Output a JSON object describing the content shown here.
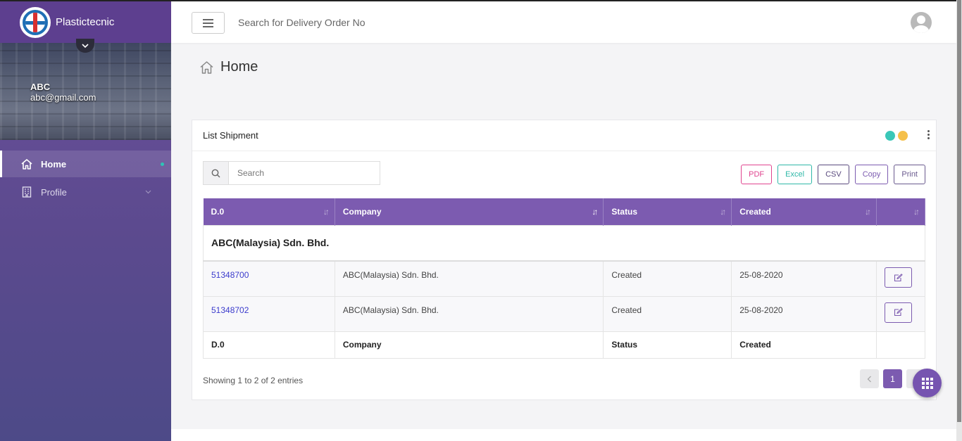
{
  "app": {
    "brand": "Plastictecnic"
  },
  "user": {
    "name": "ABC",
    "email": "abc@gmail.com"
  },
  "sidebar": {
    "items": [
      {
        "label": "Home"
      },
      {
        "label": "Profile"
      }
    ]
  },
  "topbar": {
    "search_placeholder": "Search for Delivery Order No"
  },
  "page": {
    "title": "Home"
  },
  "card": {
    "title": "List Shipment",
    "search_placeholder": "Search",
    "export_buttons": [
      "PDF",
      "Excel",
      "CSV",
      "Copy",
      "Print"
    ],
    "status_dots": [
      "#3ac7b8",
      "#f5c04a"
    ]
  },
  "table": {
    "columns": [
      "D.0",
      "Company",
      "Status",
      "Created"
    ],
    "group_label": "ABC(Malaysia) Sdn. Bhd.",
    "rows": [
      {
        "do": "51348700",
        "company": "ABC(Malaysia) Sdn. Bhd.",
        "status": "Created",
        "created": "25-08-2020"
      },
      {
        "do": "51348702",
        "company": "ABC(Malaysia) Sdn. Bhd.",
        "status": "Created",
        "created": "25-08-2020"
      }
    ],
    "footer": [
      "D.0",
      "Company",
      "Status",
      "Created"
    ]
  },
  "pagination": {
    "info": "Showing 1 to 2 of 2 entries",
    "current_page": "1"
  },
  "colors": {
    "accent": "#7c5bb0",
    "sidebar": "#5d3f8f",
    "pdf": "#e0448f",
    "excel": "#2fb8a8",
    "csv": "#5a4a7e",
    "copy": "#7c5bb0",
    "print": "#6a5a8e"
  }
}
